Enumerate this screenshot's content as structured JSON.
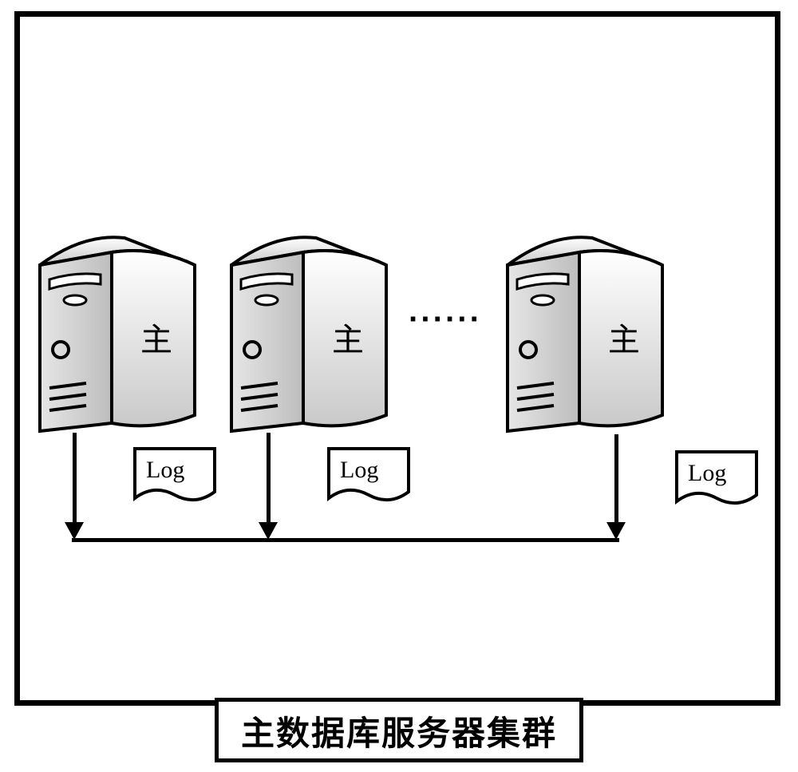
{
  "caption": "主数据库服务器集群",
  "servers": [
    {
      "label": "主",
      "log": "Log"
    },
    {
      "label": "主",
      "log": "Log"
    },
    {
      "label": "主",
      "log": "Log"
    }
  ],
  "ellipsis": "······"
}
